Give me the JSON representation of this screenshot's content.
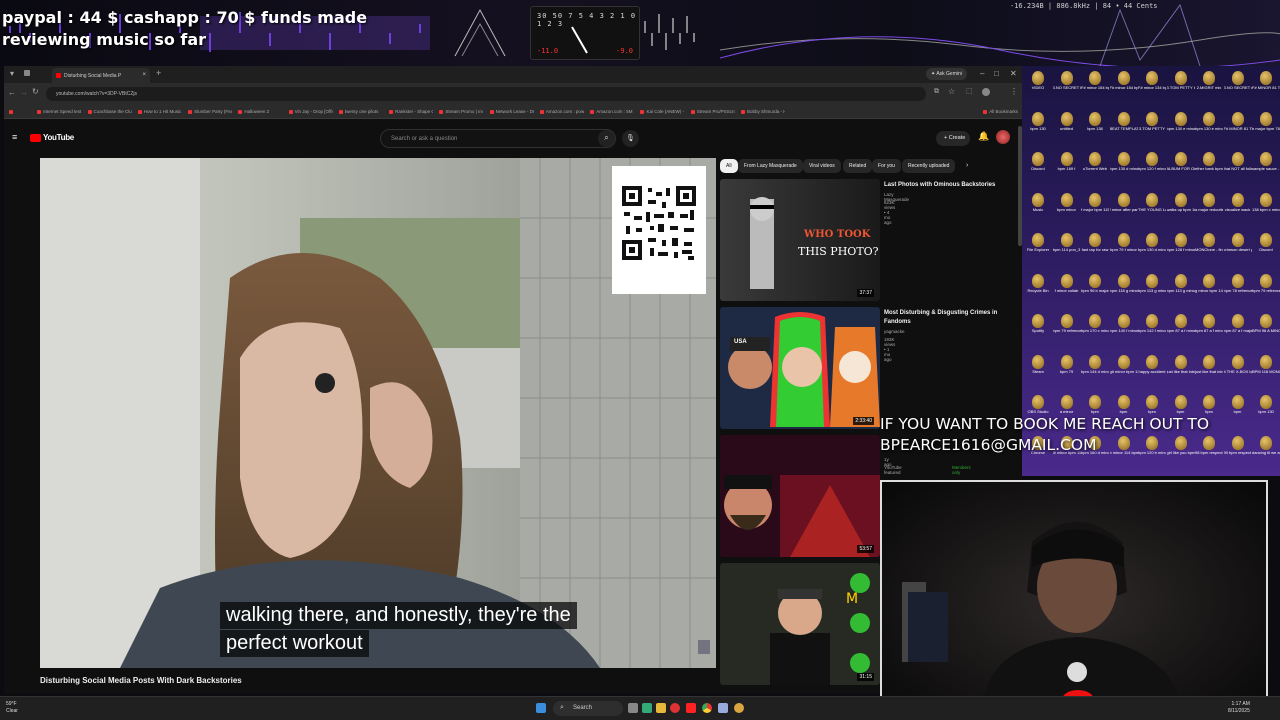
{
  "overlay": {
    "funds_line": "paypal : 44 $  cashapp : 70 $ funds made",
    "status_line": "reviewing music so far",
    "meter_scale": "30 50 7 5 4 3 2 1 0 1 2 3",
    "meter_left": "-11.0",
    "meter_right": "-9.0",
    "stats": "-16.234B | 886.8kHz | 84 • 44 Cents",
    "booking_line1": "IF YOU WANT TO BOOK ME REACH OUT TO",
    "booking_line2": "BPEARCE1616@GMAIL.COM"
  },
  "browser": {
    "tab_title": "Disturbing Social Media P",
    "ask_gemini": "Ask Gemini",
    "url": "youtube.com/watch?v=3DP-VBtCZjs",
    "all_bookmarks": "All Bookmarks",
    "bookmarks": [
      "Internet Speed test",
      "Coachbase the Club",
      "How to 1 Hit Music",
      "Slumber Party (Feat.",
      "Halloween 2",
      "Vin Jay - Drop [Offic",
      "twenty one pilots",
      "Rankster - Shape O",
      "Stream Promo | Inve",
      "Network Lease - DC",
      "Amazon.com : pow",
      "Amazon.com : 5M C",
      "Kai Cole (ANEW) - ..",
      "Stream Pro/PSScroll (Pr",
      "Bobby Shmurda - Hot Ni"
    ]
  },
  "youtube": {
    "logo": "YouTube",
    "search_placeholder": "Search or ask a question",
    "create": "Create",
    "video_title": "Disturbing Social Media Posts With Dark Backstories",
    "caption_line1": "walking there, and honestly, they're the",
    "caption_line2": "perfect workout",
    "chips": [
      "All",
      "From Lazy Masquerade",
      "Viral videos",
      "Related",
      "For you",
      "Recently uploaded"
    ],
    "recs": [
      {
        "title": "Last Photos with Ominous Backstories",
        "channel": "Lazy Masquerade",
        "meta": "623K views • 4 mo ago",
        "duration": "37:37",
        "thumb_text_1": "WHO TOOK",
        "thumb_text_2": "THIS PHOTO?"
      },
      {
        "title": "Most Disturbing & Disgusting Crimes in Fandoms",
        "channel": "yagmacke",
        "meta": "193K views • 1 mo ago",
        "duration": "2:33:40",
        "thumb_text_1": "USA"
      },
      {
        "title": "",
        "channel": "YouTube featured",
        "meta": "1y ago",
        "duration": "53:57",
        "members": "Members only"
      },
      {
        "title": "",
        "channel": "",
        "meta": "",
        "duration": "31:15"
      }
    ]
  },
  "desktop": {
    "icons": [
      "VIDEO",
      "3.NO SECRET bpm no",
      "F# minor 154 bpm no",
      "F# minor 154 bpm no",
      "F# minor 134 bpm no",
      "3.TOM PETTY bpm no",
      "2.MIGRIT mix",
      "3.NO SECRET mix",
      "F# MINOR 81 TUPAC",
      "bpm 130",
      "untitled",
      "bpm 138",
      "BEAT TEMPLATE",
      "3.TOM PETTY",
      "bpm 130 e minor",
      "bpm 130 e minor W",
      "F# MINOR 81 TUPA",
      "b major bpm 78 monday",
      "Discord",
      "bpm 169 f",
      "uTorrent Web",
      "bpm 135 d minor then",
      "bpm 120 f minor lT",
      "ALBUM FOR OCTOBER",
      "ether bank bpm 115",
      "that NOT all folks bpm",
      "sample sauce - Part_1",
      "Music",
      "bpm minor",
      "f major bpm 115 caffeine",
      "f minor after party bpm",
      "THE YOUNG LAD BPM 1",
      "walks up bpm 160 c",
      "a major redcutter bp",
      "visualize wack",
      "138 bpm c minor live",
      "File Explorer",
      "bpm 114 pon_3",
      "fast rap for raw",
      "bpm 79 f minor",
      "bpm 130 d minor last",
      "bpm 128 f minor who",
      "MONCtone - final mix",
      "crimson desert part 1",
      "Discord",
      "Recycle Bin",
      "f minor collab",
      "bpm 96 b major",
      "bpm 118 g minor",
      "bpm 113 g minor",
      "bpm 113 g minor bpm",
      "g minor bpm 144 violin",
      "bpm 78 refrence a",
      "bpm 79 refrence a",
      "Spotify",
      "bpm 79 refrence a",
      "bpm 170 c minor",
      "bpm 140 f minor flow",
      "bpm 142 f minor",
      "bpm 87 a f minor",
      "bpm 87 a f minor",
      "bpm 87 a f major",
      "BPM 98 A MINOR",
      "Steam",
      "bpm 79",
      "bpm 144 d minor",
      "g# minor bpm 115",
      "happy accident",
      "just like that intro",
      "just like that intro",
      "4 THE X-BOX bpm 115",
      "BPM 118 MONOtone",
      "OBS Studio",
      "a minor",
      "bpm",
      "bpm",
      "bpm",
      "bpm",
      "bpm",
      "bpm",
      "bpm 130",
      "Chrome",
      "f# minor bpm 118_2",
      "bpm 160 d minor lost",
      "b minor 114 bpm_3",
      "bpm 120 b minor",
      "girl like you bpm",
      "98 bpm respect e",
      "90 bpm respect e",
      "dancing til we are dea"
    ]
  },
  "taskbar": {
    "weather_temp": "59°F",
    "weather_desc": "Clear",
    "search": "Search",
    "time": "1:17 AM",
    "date": "8/11/2025"
  },
  "colors": {
    "yt_red": "#ff0000",
    "accent_purple": "#4a2a8c",
    "dark_bg": "#0f0f0f"
  }
}
